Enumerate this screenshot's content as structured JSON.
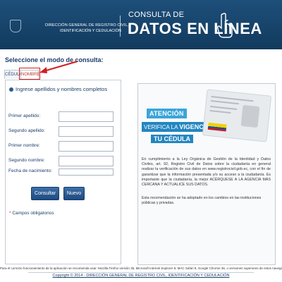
{
  "header": {
    "institution_line1": "DIRECCIÓN GENERAL DE REGISTRO CIVIL,",
    "institution_line2": "IDENTIFICACIÓN Y CEDULACIÓN",
    "title_top": "CONSULTA DE",
    "title_main": "DATOS EN LÍNEA",
    "hand_icon": "pointing-hand-icon"
  },
  "mode_selector": {
    "label": "Seleccione el modo de consulta:",
    "tabs": [
      "CÉDULA",
      "NOMBRE"
    ],
    "active_tab": "NOMBRE",
    "highlight_color": "#d02020"
  },
  "form": {
    "title": "Ingrese apellidos y nombres completos",
    "fields": [
      {
        "label": "Primer apellido:",
        "value": ""
      },
      {
        "label": "Segundo apellido:",
        "value": ""
      },
      {
        "label": "Primer nombre:",
        "value": ""
      },
      {
        "label": "Segundo nombre:",
        "value": ""
      },
      {
        "label": "Fecha de nacimiento:",
        "value": ""
      }
    ],
    "submit_label": "Consultar",
    "new_label": "Nuevo",
    "required_note": "Campos obligatorios"
  },
  "info": {
    "banner_attention": "ATENCIÓN",
    "banner_verify": "VERIFICA LA",
    "banner_validity": "VIGENCIA DE",
    "banner_cedula": "TU CÉDULA",
    "paragraph1": "En cumplimiento a la Ley Orgánica de Gestión de la Identidad y Datos Civiles, art. 92, Registro Civil de Datos sobre la ciudadanía en general realizar la verificación de sus datos en www.registrocivil.gob.ec, con el fin de garantizar que la información presentada y/o su acceso a la ciudadanía. Es importante que la ciudadanía, la mejor ACÉRQUESE A LA AGENCIA MÁS CERCANA Y ACTUALICE SUS DATOS.",
    "paragraph2": "Esta recomendación se ha adoptado en los cambios en las instituciones públicas y privadas."
  },
  "footer": {
    "compat_note": "Para el correcto funcionamiento de la aplicación se recomienda usar: Mozilla Firefox versión 35, Microsoft Internet Explorer 8, MAC Safari 8, Google Chrome 36, o versiones superiores de estos navegadores.",
    "copyright": "Copyright © 2014 - DIRECCIÓN GENERAL DE REGISTRO CIVIL, IDENTIFICACIÓN Y CEDULACIÓN"
  },
  "colors": {
    "header_bg": "#1d4f7a",
    "accent_blue": "#2286c0",
    "label_navy": "#1a3e6b",
    "required_red": "#c0392b"
  }
}
